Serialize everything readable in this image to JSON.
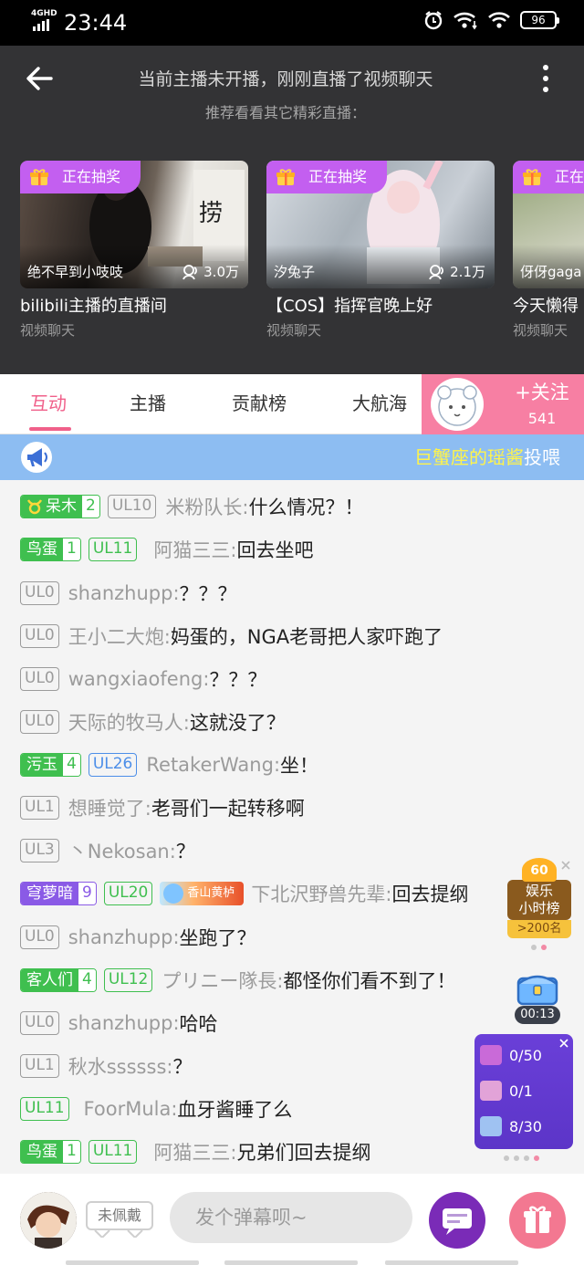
{
  "status": {
    "network": "4GHD",
    "time": "23:44",
    "battery": "96"
  },
  "header": {
    "title": "当前主播未开播，刚刚直播了视频聊天",
    "subtitle": "推荐看看其它精彩直播："
  },
  "cards": [
    {
      "badge": "正在抽奖",
      "user": "绝不早到小吱吱",
      "viewers": "3.0万",
      "title": "bilibili主播的直播间",
      "category": "视频聊天"
    },
    {
      "badge": "正在抽奖",
      "user": "汐兔子",
      "viewers": "2.1万",
      "title": "【COS】指挥官晚上好",
      "category": "视频聊天"
    },
    {
      "badge": "正在抽奖",
      "user": "伢伢gaga",
      "viewers": "",
      "title": "今天懒得",
      "category": "视频聊天"
    }
  ],
  "tabs": [
    "互动",
    "主播",
    "贡献榜",
    "大航海"
  ],
  "follow": {
    "label": "+关注",
    "count": "541"
  },
  "announcement": {
    "highlight": "巨蟹座的瑶酱",
    "rest": "投喂"
  },
  "chat": [
    {
      "medal": "呆木",
      "medal_level": "2",
      "ul": "UL10",
      "ul_color": "gray",
      "nick": "米粉队长:",
      "text": "什么情况？！"
    },
    {
      "medal": "鸟蛋",
      "medal_level": "1",
      "ul": "UL11",
      "ul_color": "green",
      "nick": "阿猫三三:",
      "text": "回去坐吧"
    },
    {
      "ul": "UL0",
      "ul_color": "gray",
      "nick": "shanzhupp:",
      "text": "？？？"
    },
    {
      "ul": "UL0",
      "ul_color": "gray",
      "nick": "王小二大炮:",
      "text": "妈蛋的，NGA老哥把人家吓跑了"
    },
    {
      "ul": "UL0",
      "ul_color": "gray",
      "nick": "wangxiaofeng:",
      "text": "？？？"
    },
    {
      "ul": "UL0",
      "ul_color": "gray",
      "nick": "天际的牧马人:",
      "text": "这就没了？"
    },
    {
      "medal": "污玉",
      "medal_level": "4",
      "ul": "UL26",
      "ul_color": "blue",
      "nick": "RetakerWang:",
      "text": "坐！"
    },
    {
      "ul": "UL1",
      "ul_color": "gray",
      "nick": "想睡觉了:",
      "text": "老哥们一起转移啊"
    },
    {
      "ul": "UL3",
      "ul_color": "gray",
      "nick": "丶Nekosan:",
      "text": "？"
    },
    {
      "medal": "穹萝暗",
      "medal_level": "9",
      "ul": "UL20",
      "ul_color": "green",
      "title_badge": "香山黄栌",
      "nick": "下北沢野兽先辈:",
      "text": "回去提纲"
    },
    {
      "ul": "UL0",
      "ul_color": "gray",
      "nick": "shanzhupp:",
      "text": "坐跑了？"
    },
    {
      "medal": "客人们",
      "medal_level": "4",
      "ul": "UL12",
      "ul_color": "green",
      "nick": "プリニー隊長:",
      "text": "都怪你们看不到了！"
    },
    {
      "ul": "UL0",
      "ul_color": "gray",
      "nick": "shanzhupp:",
      "text": "哈哈"
    },
    {
      "ul": "UL1",
      "ul_color": "gray",
      "nick": "秋水ssssss:",
      "text": "？"
    },
    {
      "ul": "UL11",
      "ul_color": "green",
      "nick": "FoorMula:",
      "text": "血牙酱睡了么"
    },
    {
      "medal": "鸟蛋",
      "medal_level": "1",
      "ul": "UL11",
      "ul_color": "green",
      "nick": "阿猫三三:",
      "text": "兄弟们回去提纲"
    }
  ],
  "rank_widget": {
    "badge": "60",
    "title": "娱乐",
    "subtitle": "小时榜",
    "more": ">200名"
  },
  "chest_timer": "00:13",
  "tasks": [
    "0/50",
    "0/1",
    "8/30"
  ],
  "bottom": {
    "wear_label": "未佩戴",
    "danmu_placeholder": "发个弹幕呗~"
  },
  "colors": {
    "accent": "#f0608a",
    "medal_green": "#3fbf4f",
    "medal_purple": "#8a5ae6",
    "ul_blue": "#4c8ee8"
  },
  "icons": [
    "back-arrow-icon",
    "more-vertical-icon",
    "gift-icon",
    "viewers-icon",
    "megaphone-icon",
    "close-icon",
    "danmu-chat-icon",
    "gift-box-icon"
  ]
}
